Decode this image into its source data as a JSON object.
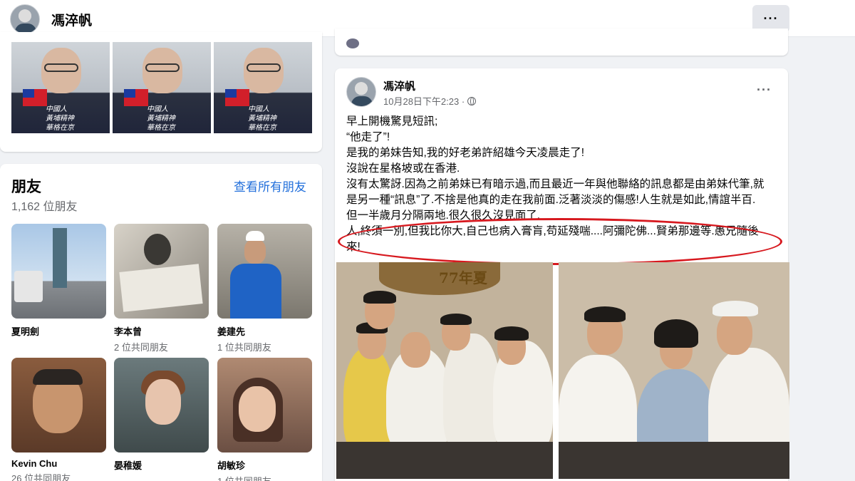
{
  "header": {
    "name": "馮淬帆",
    "more_label": "···"
  },
  "photos": {
    "captions": [
      "中國人\n黃埔精神\n華格在京",
      "中國人\n黃埔精神\n華格在京",
      "中國人\n黃埔精神\n華格在京"
    ]
  },
  "friends": {
    "title": "朋友",
    "count": "1,162 位朋友",
    "see_all": "查看所有朋友",
    "items": [
      {
        "name": "夏明劍",
        "mutual": ""
      },
      {
        "name": "李本曾",
        "mutual": "2 位共同朋友"
      },
      {
        "name": "姜建先",
        "mutual": "1 位共同朋友"
      },
      {
        "name": "Kevin Chu",
        "mutual": "26 位共同朋友"
      },
      {
        "name": "晏稚媛",
        "mutual": ""
      },
      {
        "name": "胡敏珍",
        "mutual": "1 位共同朋友"
      }
    ]
  },
  "post": {
    "author": "馮淬帆",
    "time": "10月28日下午2:23 ·",
    "menu_label": "···",
    "lines": [
      "早上開機驚見短訊;",
      "“他走了”!",
      "是我的弟妹告知,我的好老弟許紹雄今天凌晨走了!",
      "沒說在星格坡或在香港.",
      "沒有太驚訝.因為之前弟妹已有暗示過,而且最近一年與他聯絡的訊息都是由弟妹代筆,就",
      "是另一種“訊息”了.不捨是他真的走在我前面.泛著淡淡的傷感!人生就是如此,情誼半百.",
      "但一半歲月分隔兩地.很久很久沒見面了.",
      "人,終須一別,但我比你大,自己也病入膏肓,苟延殘喘....阿彌陀佛...賢弟那邊等.愚兄隨後",
      "來!"
    ],
    "photo_label": "77年夏"
  },
  "colors": {
    "link": "#216fdb",
    "highlight_circle": "#d7191f"
  }
}
